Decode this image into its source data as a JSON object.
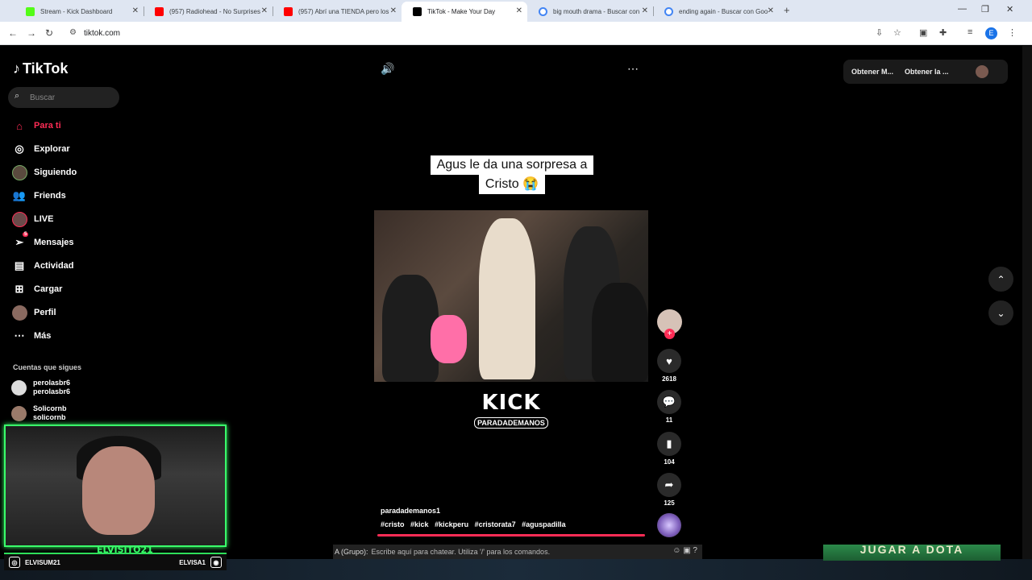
{
  "browser": {
    "tabs": [
      {
        "label": "Stream - Kick Dashboard",
        "color": "#53fc18"
      },
      {
        "label": "(957) Radiohead - No Surprises",
        "color": "#ff0000"
      },
      {
        "label": "(957) Abrí una TIENDA pero los",
        "color": "#ff0000"
      },
      {
        "label": "TikTok - Make Your Day",
        "color": "#000000"
      },
      {
        "label": "big mouth drama - Buscar con",
        "color": "#4285f4"
      },
      {
        "label": "ending again - Buscar con Goo",
        "color": "#4285f4"
      }
    ],
    "url": "tiktok.com",
    "profile_initial": "E"
  },
  "tiktok": {
    "logo": "TikTok",
    "search_placeholder": "Buscar",
    "nav": [
      {
        "label": "Para ti",
        "icon": "home-icon"
      },
      {
        "label": "Explorar",
        "icon": "compass-icon"
      },
      {
        "label": "Siguiendo",
        "icon": "following-avatar-icon"
      },
      {
        "label": "Friends",
        "icon": "friends-icon"
      },
      {
        "label": "LIVE",
        "icon": "live-avatar-icon"
      },
      {
        "label": "Mensajes",
        "icon": "messages-icon",
        "badge": "5"
      },
      {
        "label": "Actividad",
        "icon": "activity-icon"
      },
      {
        "label": "Cargar",
        "icon": "upload-icon"
      },
      {
        "label": "Perfil",
        "icon": "profile-avatar-icon"
      },
      {
        "label": "Más",
        "icon": "more-icon"
      }
    ],
    "following_title": "Cuentas que sigues",
    "following": [
      {
        "name": "perolasbr6",
        "handle": "perolasbr6"
      },
      {
        "name": "Solicornb",
        "handle": "solicornb"
      }
    ],
    "top_right": {
      "coins": "Obtener M...",
      "app": "Obtener la ..."
    },
    "video": {
      "caption_line1": "Agus le da una sorpresa a",
      "caption_line2": "Cristo 😭",
      "kick_logo": "KICK",
      "kick_handle": "PARADADEMANOS",
      "username": "paradademanos1",
      "hashtags": [
        "#cristo",
        "#kick",
        "#kickperu",
        "#cristorata7",
        "#aguspadilla"
      ],
      "likes": "2618",
      "comments": "11",
      "saves": "104",
      "shares": "125"
    }
  },
  "stream_overlay": {
    "name": "ELVISITO21",
    "left_handle": "ELVISUM21",
    "right_handle": "ELVISA1",
    "chat_label": "A (Grupo):",
    "chat_placeholder": "Escribe aquí para chatear. Utiliza '/' para los comandos.",
    "game_button": "JUGAR A DOTA"
  }
}
